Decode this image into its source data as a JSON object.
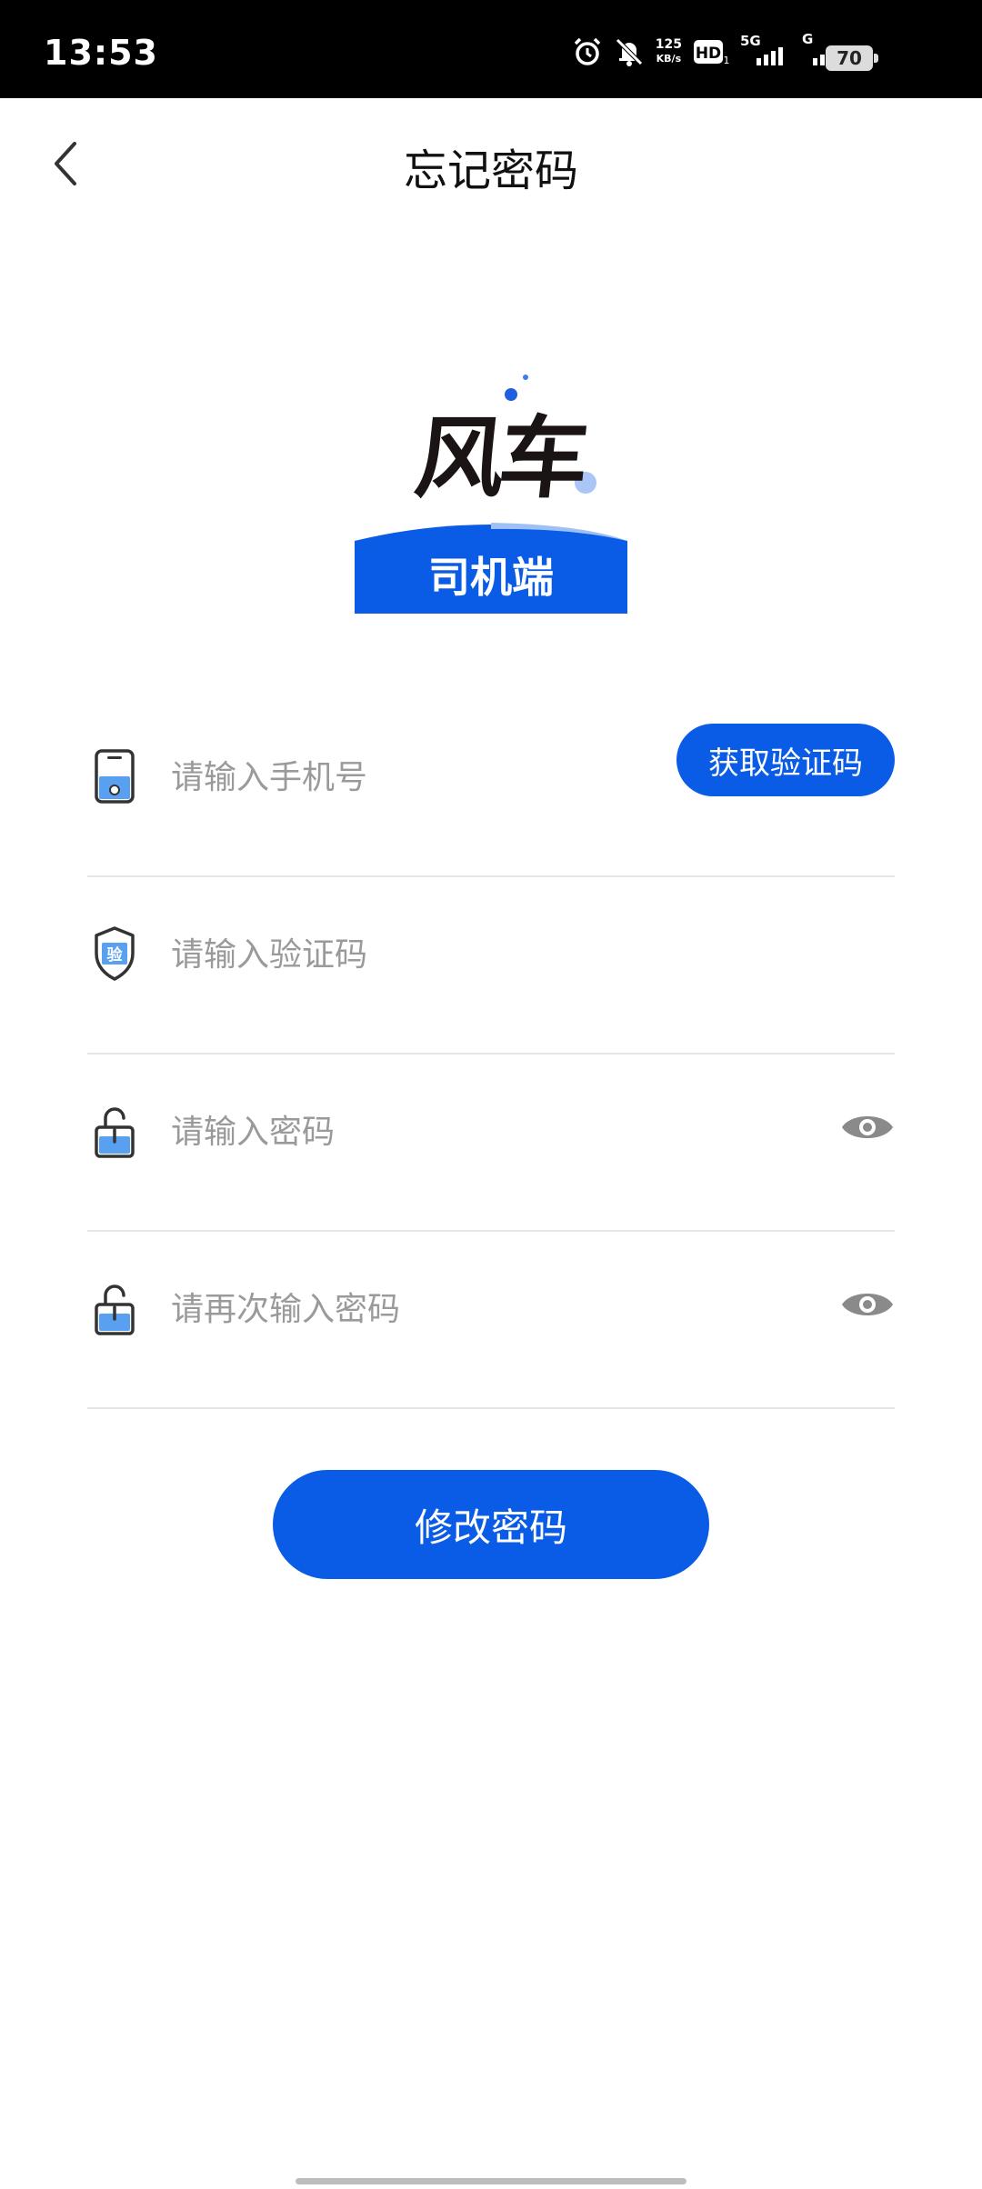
{
  "status_bar": {
    "time": "13:53",
    "speed": "125",
    "speed_unit": "KB/s",
    "network_1": "5G",
    "network_2": "G",
    "battery": "70"
  },
  "header": {
    "title": "忘记密码"
  },
  "logo": {
    "brand": "风车",
    "subtitle": "司机端"
  },
  "form": {
    "phone": {
      "placeholder": "请输入手机号",
      "value": ""
    },
    "get_code_label": "获取验证码",
    "code": {
      "placeholder": "请输入验证码",
      "value": ""
    },
    "password": {
      "placeholder": "请输入密码",
      "value": ""
    },
    "confirm_password": {
      "placeholder": "请再次输入密码",
      "value": ""
    }
  },
  "submit_label": "修改密码",
  "colors": {
    "primary": "#0a5ce6",
    "icon_fill": "#5aa0f0",
    "divider": "#e6e6e6"
  }
}
